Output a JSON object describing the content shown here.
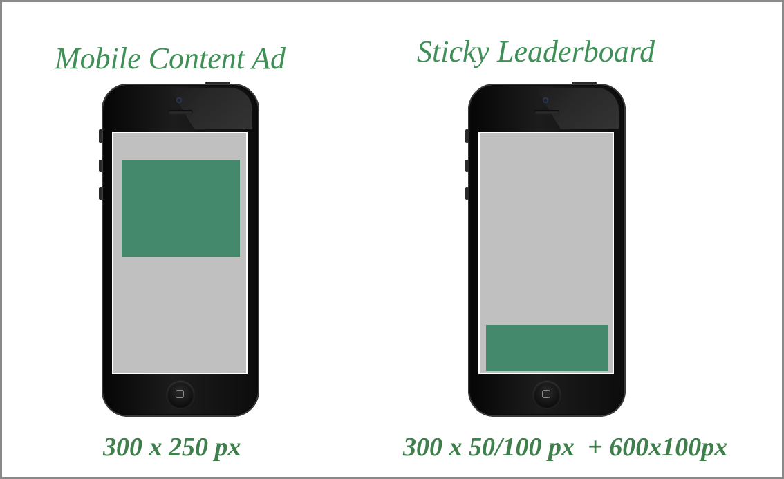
{
  "colors": {
    "title_text": "#3f8f57",
    "caption_text": "#3f7f4c",
    "ad_block": "#44896c",
    "screen": "#c0c0c0",
    "frame_border": "#8a8a8a"
  },
  "panels": [
    {
      "title": "Mobile Content Ad",
      "caption": "300 x 250 px",
      "ad_position": "upper screen"
    },
    {
      "title": "Sticky Leaderboard",
      "caption": "300 x 50/100 px  + 600x100px",
      "ad_position": "bottom of screen"
    }
  ]
}
